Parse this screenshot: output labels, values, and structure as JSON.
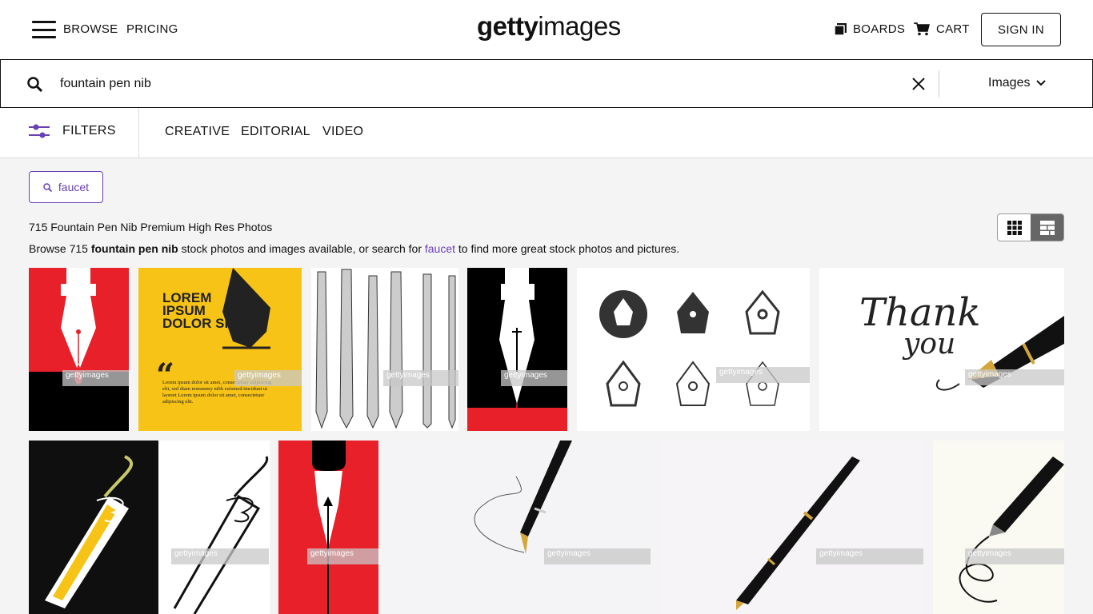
{
  "header": {
    "browse_label": "BROWSE",
    "pricing_label": "PRICING",
    "logo_bold": "getty",
    "logo_light": "images",
    "boards_label": "BOARDS",
    "cart_label": "CART",
    "signin_label": "SIGN IN"
  },
  "search": {
    "value": "fountain pen nib",
    "type_label": "Images"
  },
  "filters": {
    "filters_label": "FILTERS",
    "tabs": [
      "CREATIVE",
      "EDITORIAL",
      "VIDEO"
    ]
  },
  "suggestion_chip": "faucet",
  "results": {
    "title": "715 Fountain Pen Nib Premium High Res Photos",
    "desc_prefix": "Browse 715 ",
    "desc_bold": "fountain pen nib",
    "desc_middle": " stock photos and images available, or search for ",
    "desc_link": "faucet",
    "desc_suffix": " to find more great stock photos and pictures."
  },
  "watermark_text": "gettyimages",
  "tiles": [
    {
      "label": "Red nib poster"
    },
    {
      "label": "LOREM IPSUM DOLOR SIT",
      "body": "Lorem ipsum dolor sit amet, consectetuer adipiscing elit, sed diam nonummy nibh euismod tincidunt ut laoreet Lorem ipsum dolor sit amet, consectetuer adipiscing elit."
    },
    {
      "label": "Sketched pens"
    },
    {
      "label": "Black nib poster"
    },
    {
      "label": "Nib icons"
    },
    {
      "label": "Thank you",
      "line1": "Thank",
      "line2": "you"
    },
    {
      "label": "Yellow nib"
    },
    {
      "label": "Line nib"
    },
    {
      "label": "Red nib arrow"
    },
    {
      "label": "Pen writing curve"
    },
    {
      "label": "Black fountain pen"
    },
    {
      "label": "Pen swirl"
    }
  ],
  "colors": {
    "accent": "#6a3fb5",
    "red": "#e8202a",
    "yellow": "#f7c316"
  }
}
